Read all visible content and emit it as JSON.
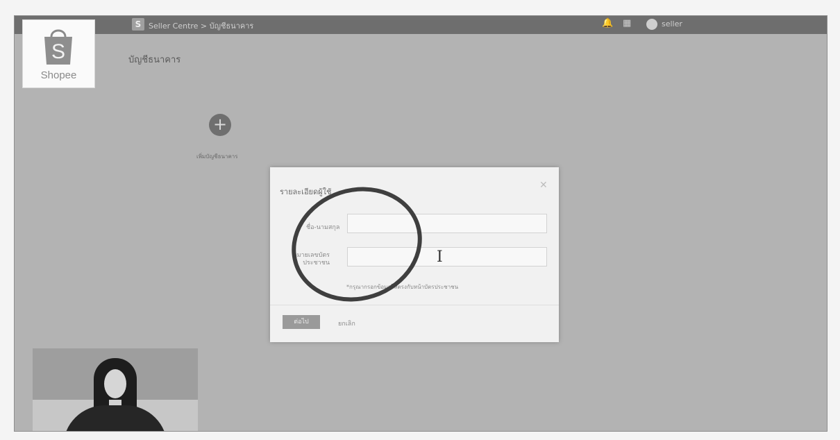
{
  "topbar": {
    "app_icon_letter": "S",
    "title": "Seller Centre > บัญชีธนาคาร",
    "username": "seller"
  },
  "logo": {
    "text": "Shopee"
  },
  "page": {
    "title": "บัญชีธนาคาร"
  },
  "add_bank": {
    "label": "เพิ่มบัญชีธนาคาร"
  },
  "modal": {
    "title": "รายละเอียดผู้ใช้",
    "field1_label": "ชื่อ-นามสกุล",
    "field2_label": "หมายเลขบัตรประชาชน",
    "note": "*กรุณากรอกข้อมูลให้ตรงกับหน้าบัตรประชาชน",
    "confirm_label": "ต่อไป",
    "cancel_label": "ยกเลิก"
  },
  "colors": {
    "overlay": "#b3b3b3",
    "topbar": "#6e6e6e",
    "highlight_ring": "#3f3f3f"
  }
}
